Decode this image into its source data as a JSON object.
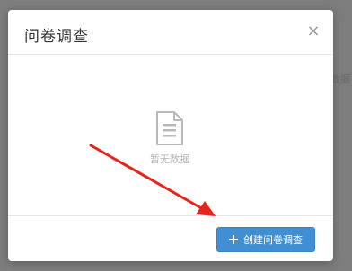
{
  "backdrop": {
    "text": "数据"
  },
  "dialog": {
    "title": "问卷调查",
    "close_glyph": "×",
    "empty_state": {
      "icon": "document-icon",
      "text": "暂无数据"
    },
    "footer": {
      "create_button_label": "创建问卷调查",
      "create_button_icon": "plus-icon"
    }
  },
  "colors": {
    "primary": "#3f8fd2",
    "annotation_arrow": "#e8231c",
    "empty_text": "#b5b5b5"
  }
}
